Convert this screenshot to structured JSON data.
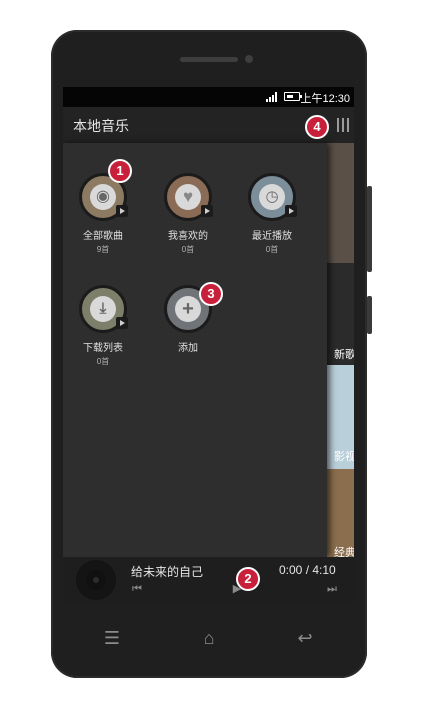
{
  "status_bar": {
    "time": "上午12:30",
    "icons": [
      "signal-icon",
      "battery-icon"
    ]
  },
  "header": {
    "title": "本地音乐",
    "menu_icon": "menu-icon"
  },
  "library": {
    "tiles": [
      {
        "name": "全部歌曲",
        "count": "9首",
        "icon": "disc-icon"
      },
      {
        "name": "我喜欢的",
        "count": "0首",
        "icon": "heart-icon"
      },
      {
        "name": "最近播放",
        "count": "0首",
        "icon": "clock-icon"
      },
      {
        "name": "下载列表",
        "count": "0首",
        "icon": "download-icon"
      },
      {
        "name": "添加",
        "icon": "plus-icon"
      }
    ]
  },
  "peek_panel": {
    "labels": [
      "新歌",
      "影视",
      "经典"
    ]
  },
  "player": {
    "song": "给未来的自己",
    "duration": "0:00 / 4:10",
    "controls": [
      "prev-icon",
      "play-icon",
      "next-icon"
    ]
  },
  "annotations": [
    "1",
    "2",
    "3",
    "4"
  ],
  "nav_bar": {
    "buttons": [
      "menu-icon",
      "home-icon",
      "back-icon"
    ]
  },
  "colors": {
    "badge": "#c8203a",
    "background": "#262626",
    "header": "#232323"
  }
}
